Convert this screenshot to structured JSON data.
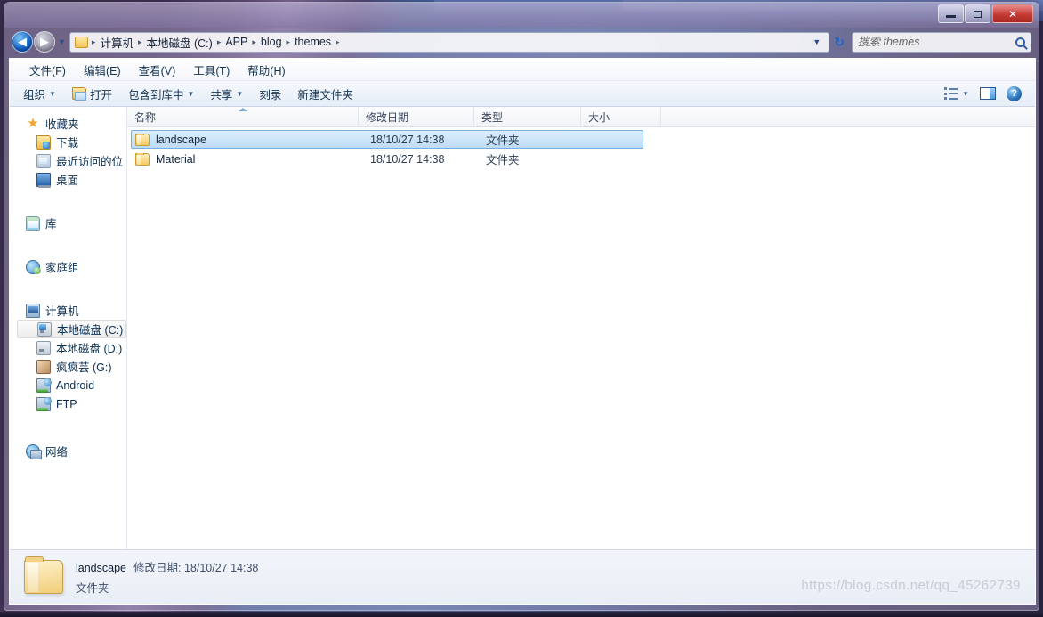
{
  "window": {
    "controls": {
      "minimize_label": "–",
      "maximize_label": "□",
      "close_label": "✕"
    }
  },
  "address_bar": {
    "back_label": "◀",
    "forward_label": "▶",
    "history_caret": "▼",
    "breadcrumbs": [
      {
        "label": "计算机"
      },
      {
        "label": "本地磁盘 (C:)"
      },
      {
        "label": "APP"
      },
      {
        "label": "blog"
      },
      {
        "label": "themes"
      }
    ],
    "separator": "▸",
    "dropdown_caret": "▼",
    "refresh_label": "↻"
  },
  "search": {
    "placeholder": "搜索 themes",
    "value": ""
  },
  "menu": {
    "items": [
      {
        "label": "文件(F)"
      },
      {
        "label": "编辑(E)"
      },
      {
        "label": "查看(V)"
      },
      {
        "label": "工具(T)"
      },
      {
        "label": "帮助(H)"
      }
    ]
  },
  "toolbar": {
    "organize_label": "组织",
    "open_label": "打开",
    "include_library_label": "包含到库中",
    "share_label": "共享",
    "burn_label": "刻录",
    "new_folder_label": "新建文件夹",
    "caret": "▼",
    "help_label": "?"
  },
  "sidebar": {
    "groups": [
      {
        "header": {
          "label": "收藏夹",
          "icon": "star-icon"
        },
        "items": [
          {
            "label": "下载",
            "icon": "download-icon"
          },
          {
            "label": "最近访问的位",
            "icon": "recent-places-icon"
          },
          {
            "label": "桌面",
            "icon": "desktop-icon"
          }
        ]
      },
      {
        "header": {
          "label": "库",
          "icon": "library-icon"
        },
        "items": []
      },
      {
        "header": {
          "label": "家庭组",
          "icon": "homegroup-icon"
        },
        "items": []
      },
      {
        "header": {
          "label": "计算机",
          "icon": "computer-icon"
        },
        "items": [
          {
            "label": "本地磁盘 (C:)",
            "icon": "system-drive-icon",
            "selected": true
          },
          {
            "label": "本地磁盘 (D:)",
            "icon": "drive-icon"
          },
          {
            "label": "疯疯芸 (G:)",
            "icon": "custom-drive-icon"
          },
          {
            "label": "Android",
            "icon": "network-drive-icon"
          },
          {
            "label": "FTP",
            "icon": "network-drive-icon"
          }
        ]
      },
      {
        "header": {
          "label": "网络",
          "icon": "network-icon"
        },
        "items": []
      }
    ]
  },
  "file_list": {
    "columns": [
      {
        "key": "name",
        "label": "名称",
        "sorted": true
      },
      {
        "key": "date",
        "label": "修改日期"
      },
      {
        "key": "type",
        "label": "类型"
      },
      {
        "key": "size",
        "label": "大小"
      }
    ],
    "rows": [
      {
        "name": "landscape",
        "date": "18/10/27 14:38",
        "type": "文件夹",
        "size": "",
        "selected": true
      },
      {
        "name": "Material",
        "date": "18/10/27 14:38",
        "type": "文件夹",
        "size": "",
        "selected": false
      }
    ]
  },
  "status_bar": {
    "name": "landscape",
    "meta": "修改日期: 18/10/27 14:38",
    "type": "文件夹"
  },
  "watermark": {
    "text": "https://blog.csdn.net/qq_45262739"
  }
}
